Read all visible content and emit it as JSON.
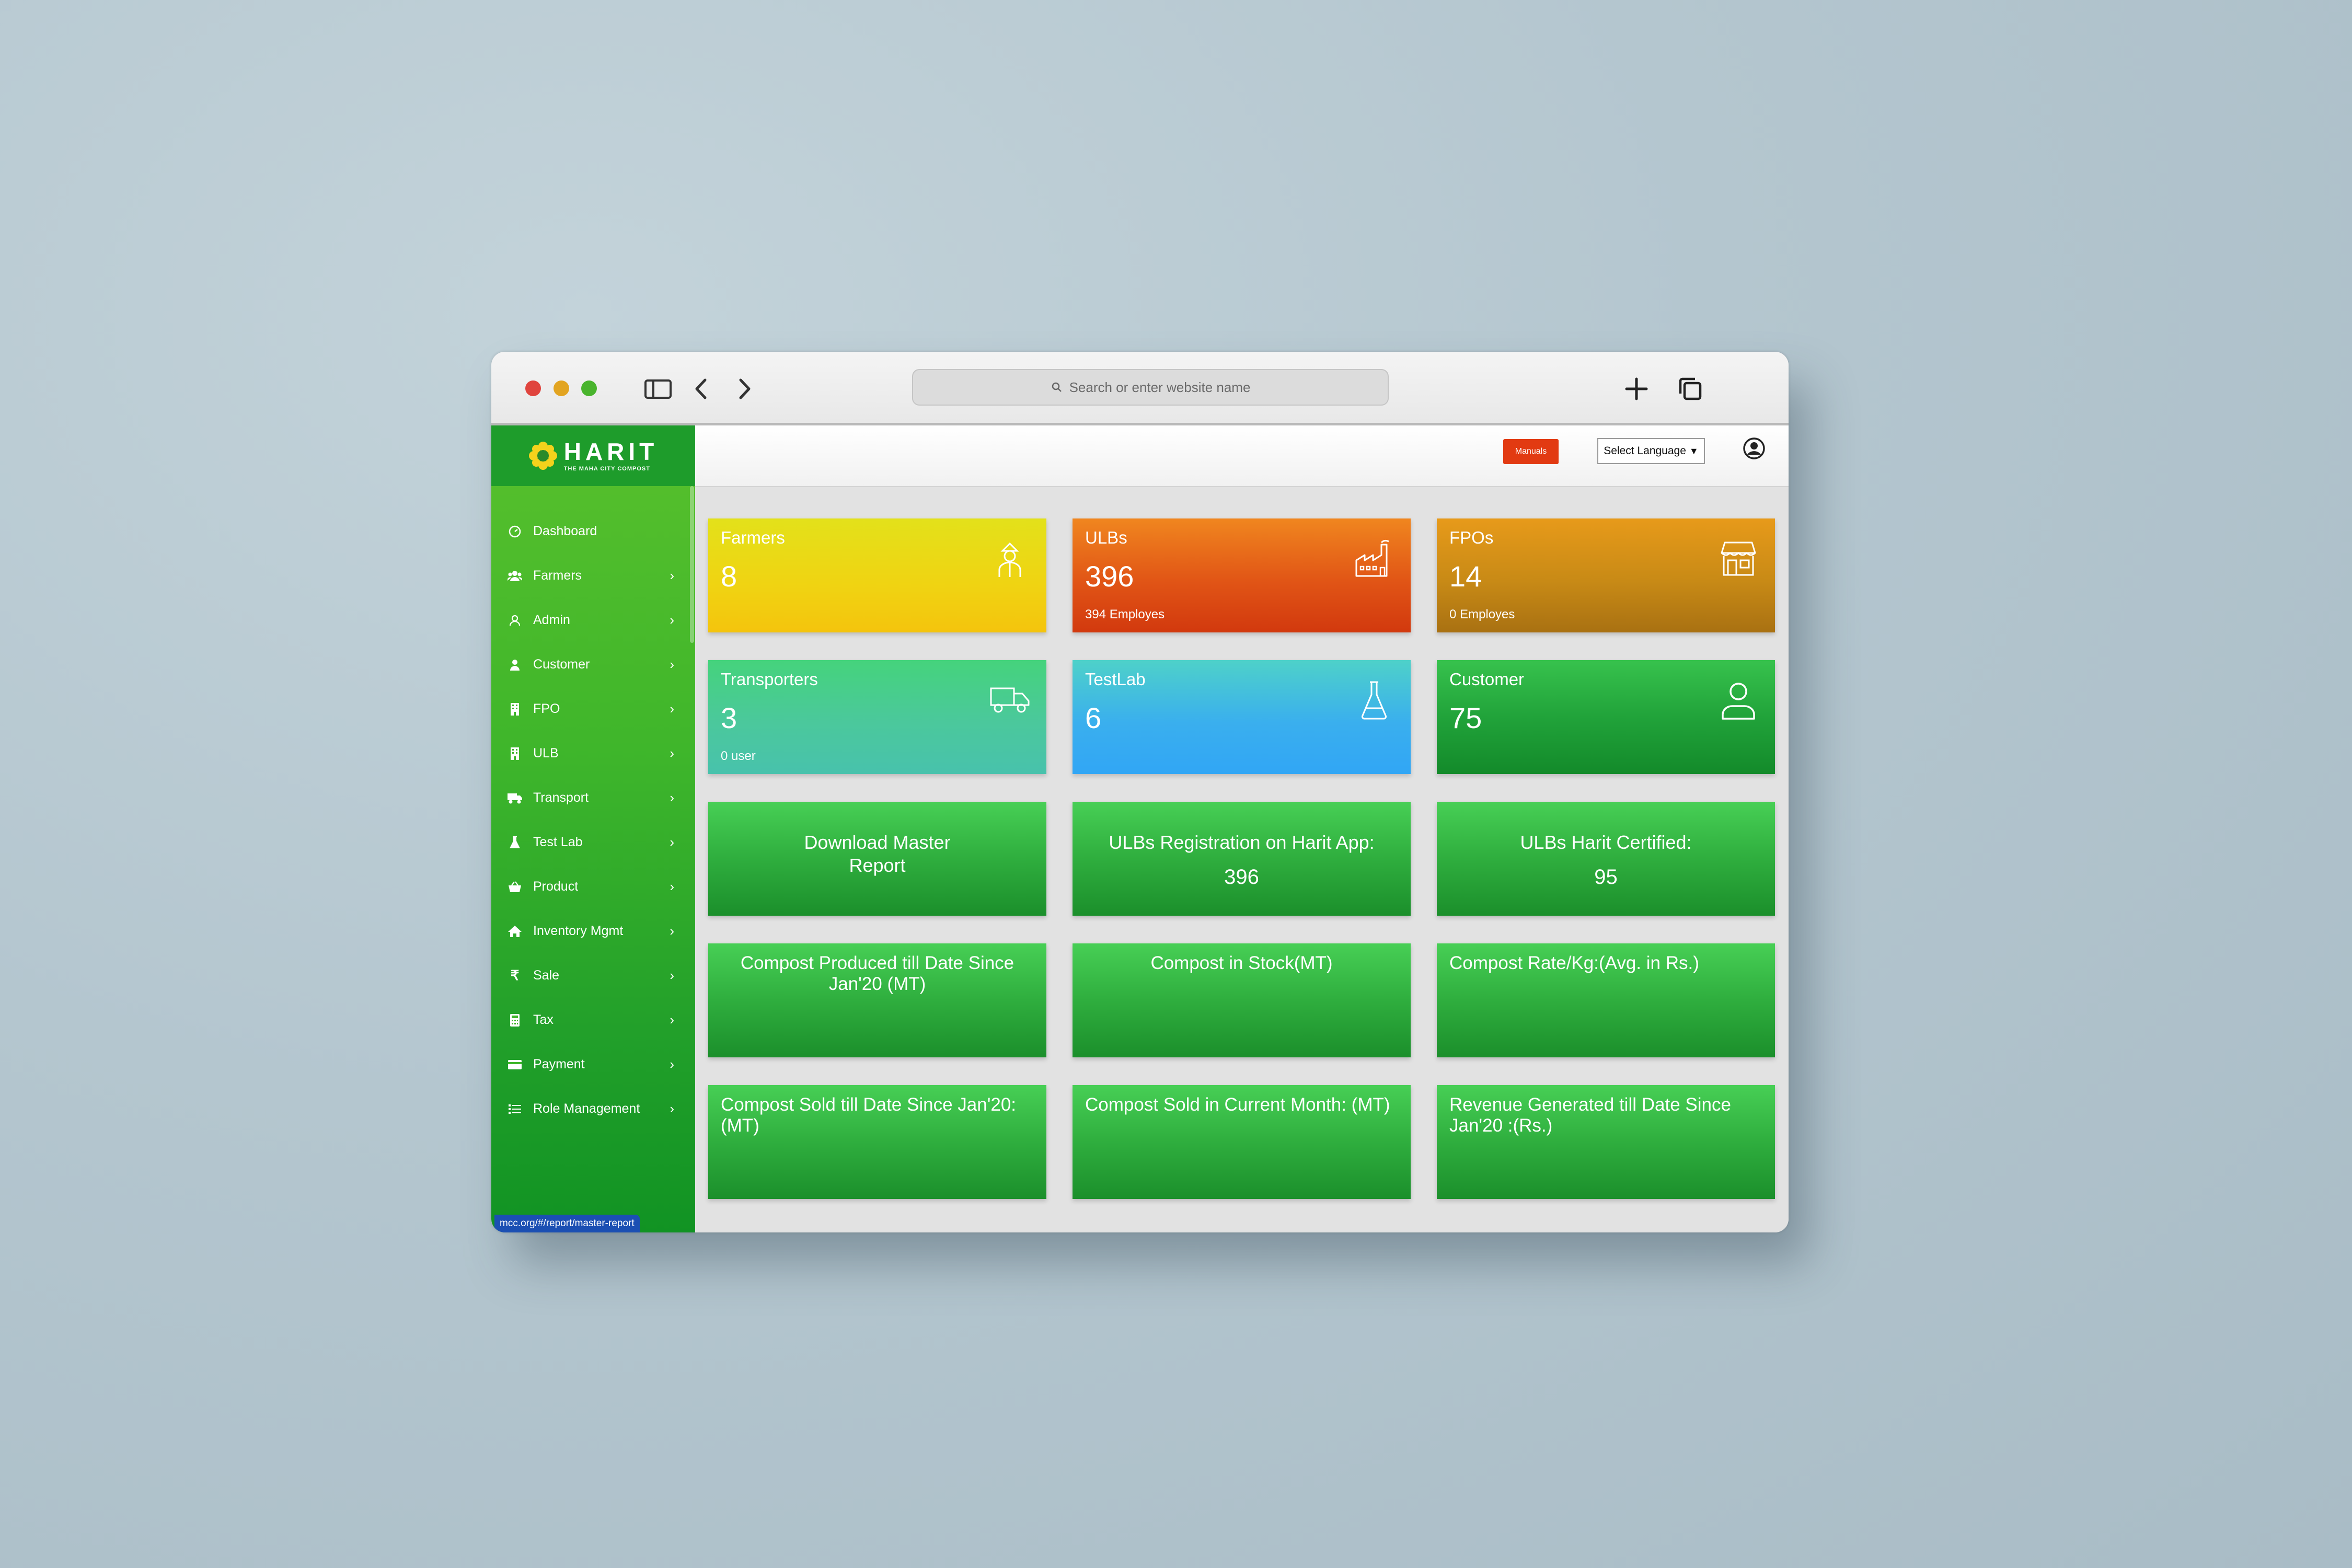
{
  "browser": {
    "address_placeholder": "Search or enter website name"
  },
  "brand": {
    "name": "HARIT",
    "tagline": "THE MAHA CITY COMPOST"
  },
  "header": {
    "manuals_label": "Manuals",
    "language_label": "Select Language"
  },
  "sidebar": {
    "items": [
      {
        "label": "Dashboard",
        "icon": "dashboard-icon",
        "chevron": false
      },
      {
        "label": "Farmers",
        "icon": "users-icon",
        "chevron": true
      },
      {
        "label": "Admin",
        "icon": "admin-icon",
        "chevron": true
      },
      {
        "label": "Customer",
        "icon": "person-icon",
        "chevron": true
      },
      {
        "label": "FPO",
        "icon": "building-icon",
        "chevron": true
      },
      {
        "label": "ULB",
        "icon": "building-icon",
        "chevron": true
      },
      {
        "label": "Transport",
        "icon": "truck-icon",
        "chevron": true
      },
      {
        "label": "Test Lab",
        "icon": "flask-icon",
        "chevron": true
      },
      {
        "label": "Product",
        "icon": "basket-icon",
        "chevron": true
      },
      {
        "label": "Inventory Mgmt",
        "icon": "home-icon",
        "chevron": true
      },
      {
        "label": "Sale",
        "icon": "rupee-icon",
        "chevron": true
      },
      {
        "label": "Tax",
        "icon": "calculator-icon",
        "chevron": true
      },
      {
        "label": "Payment",
        "icon": "card-icon",
        "chevron": true
      },
      {
        "label": "Role Management",
        "icon": "list-icon",
        "chevron": true
      }
    ]
  },
  "status_url": "mcc.org/#/report/master-report",
  "cards": {
    "farmers": {
      "title": "Farmers",
      "value": "8",
      "color": "#e8dc16"
    },
    "ulbs": {
      "title": "ULBs",
      "value": "396",
      "sub": "394 Employes",
      "color": "#e15516"
    },
    "fpos": {
      "title": "FPOs",
      "value": "14",
      "sub": "0 Employes",
      "color": "#c88a16"
    },
    "transporters": {
      "title": "Transporters",
      "value": "3",
      "sub": "0 user",
      "color": "#4bc89c"
    },
    "testlab": {
      "title": "TestLab",
      "value": "6",
      "color": "#3aafee"
    },
    "customer": {
      "title": "Customer",
      "value": "75",
      "color": "#21a33a"
    },
    "download_master": {
      "title": "Download Master Report"
    },
    "ulb_registration": {
      "title": "ULBs Registration on Harit App:",
      "value": "396"
    },
    "ulb_certified": {
      "title": "ULBs Harit Certified:",
      "value": "95"
    },
    "compost_produced": {
      "title": "Compost Produced till Date Since Jan'20 (MT)"
    },
    "compost_stock": {
      "title": "Compost in Stock(MT)"
    },
    "compost_rate": {
      "title": "Compost Rate/Kg:(Avg. in Rs.)"
    },
    "compost_sold": {
      "title": "Compost Sold till Date Since Jan'20: (MT)"
    },
    "compost_sold_month": {
      "title": "Compost Sold in Current Month: (MT)"
    },
    "revenue": {
      "title": "Revenue Generated till Date Since Jan'20 :(Rs.)"
    }
  }
}
